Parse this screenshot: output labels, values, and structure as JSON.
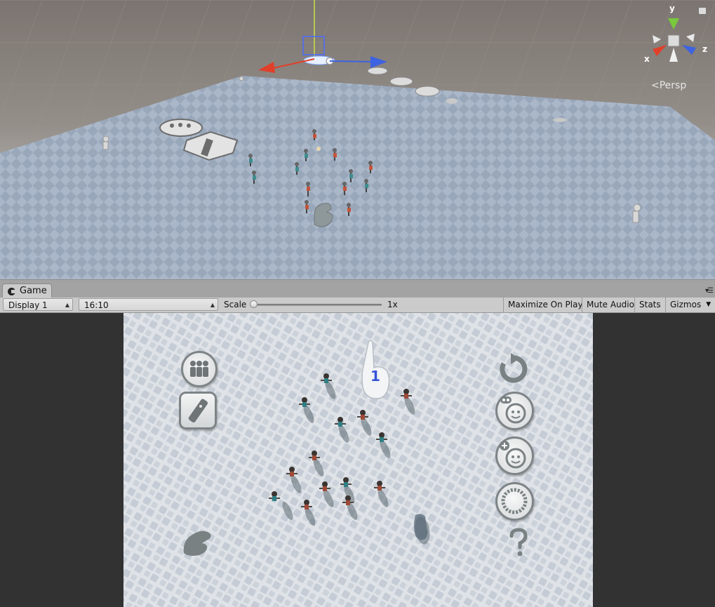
{
  "scene": {
    "persp_label": "<Persp",
    "gizmo_axes": {
      "x": "x",
      "y": "y",
      "z": "z"
    },
    "colors": {
      "x_axis": "#e0402a",
      "y_axis": "#79c83e",
      "z_axis": "#3d63e0"
    }
  },
  "game_tab": {
    "title": "Game"
  },
  "toolbar": {
    "display": "Display 1",
    "aspect": "16:10",
    "scale_label": "Scale",
    "scale_value": "1x",
    "scale_fraction": 0.0,
    "maximize": "Maximize On Play",
    "mute": "Mute Audio",
    "stats": "Stats",
    "gizmos": "Gizmos"
  },
  "game": {
    "finger_count": "1",
    "left_buttons": [
      "people-group-icon",
      "remote-control-icon"
    ],
    "right_buttons": [
      "restart-icon",
      "bot-face-icon",
      "add-face-icon",
      "circle-dial-icon",
      "help-icon"
    ]
  }
}
